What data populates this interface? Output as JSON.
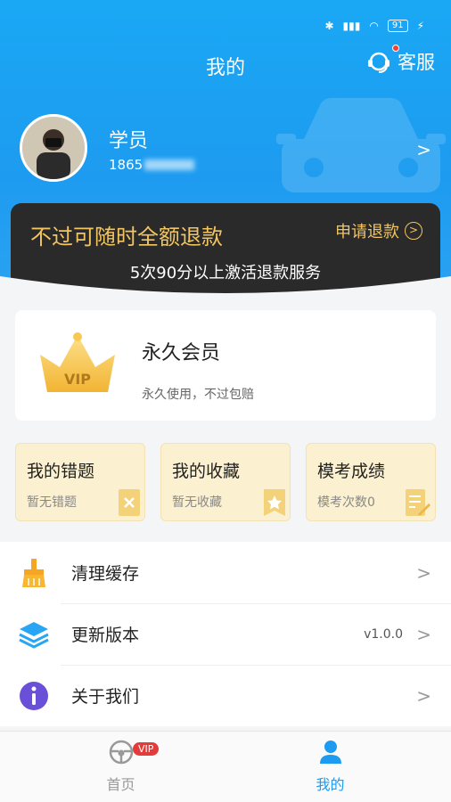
{
  "status_bar": {
    "battery": "91"
  },
  "header": {
    "title": "我的",
    "service_label": "客服"
  },
  "profile": {
    "name": "学员",
    "phone_visible": "1865"
  },
  "refund": {
    "title": "不过可随时全额退款",
    "action_label": "申请退款",
    "subtitle": "5次90分以上激活退款服务"
  },
  "vip": {
    "badge_text": "VIP",
    "title": "永久会员",
    "subtitle": "永久使用，不过包赔"
  },
  "quick_cards": [
    {
      "title": "我的错题",
      "sub": "暂无错题",
      "icon": "wrong-book-icon"
    },
    {
      "title": "我的收藏",
      "sub": "暂无收藏",
      "icon": "star-bookmark-icon"
    },
    {
      "title": "模考成绩",
      "sub": "模考次数0",
      "icon": "exam-edit-icon"
    }
  ],
  "menu": [
    {
      "label": "清理缓存",
      "value": "",
      "icon": "broom-icon"
    },
    {
      "label": "更新版本",
      "value": "v1.0.0",
      "icon": "layers-icon"
    },
    {
      "label": "关于我们",
      "value": "",
      "icon": "info-icon"
    }
  ],
  "tabbar": {
    "home_label": "首页",
    "home_badge": "VIP",
    "mine_label": "我的"
  },
  "colors": {
    "primary": "#1d9bf0",
    "gold": "#f3c561",
    "banner_dark": "#2a2a2a",
    "quick_bg": "#fbf0cf"
  }
}
